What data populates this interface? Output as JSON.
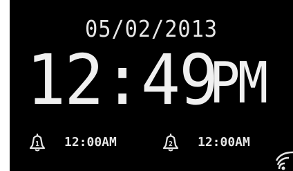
{
  "display": {
    "date": "05/02/2013",
    "time": "12:49",
    "ampm": "PM",
    "background_color": "#000000",
    "text_color": "#f0f0f0"
  },
  "alarms": [
    {
      "number": "1",
      "time": "12:00AM",
      "icon": "alarm-bell-icon"
    },
    {
      "number": "2",
      "time": "12:00AM",
      "icon": "alarm-bell-icon"
    }
  ],
  "status": {
    "signal_icon": "wifi-signal-icon"
  }
}
